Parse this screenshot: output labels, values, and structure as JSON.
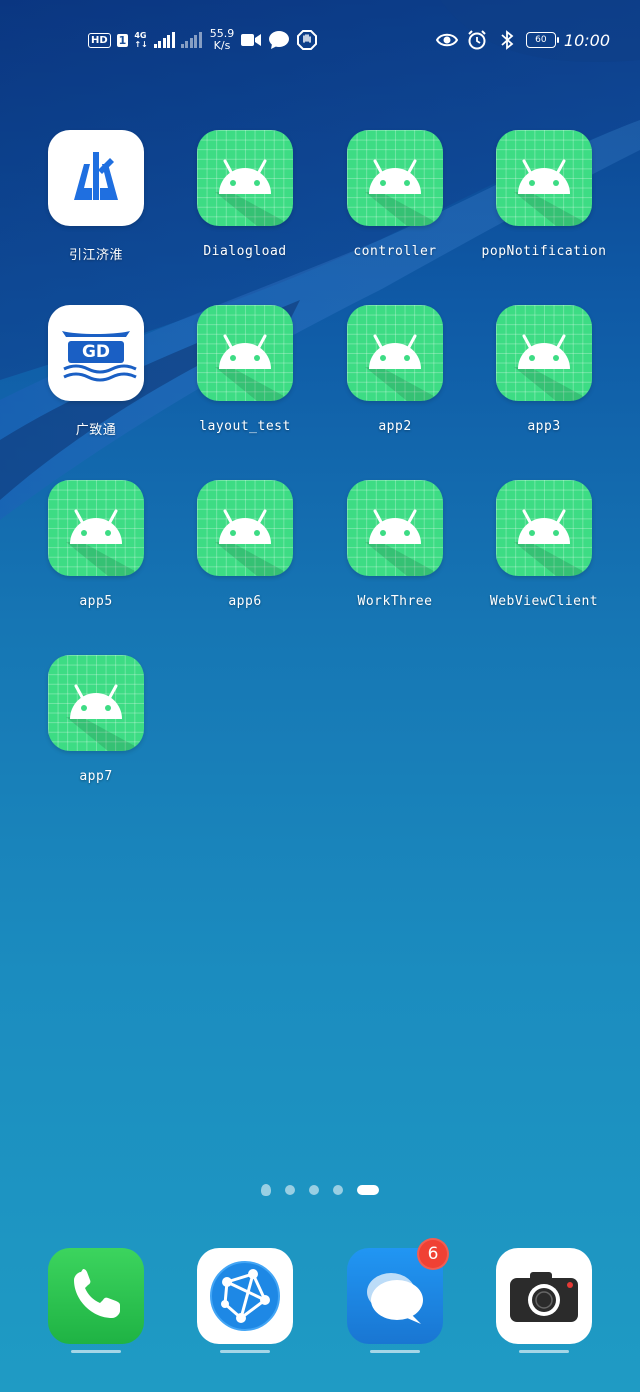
{
  "status_bar": {
    "hd": "HD",
    "sim": "1",
    "net": "4G",
    "net_sub": "↑↓",
    "speed_value": "55.9",
    "speed_unit": "K/s",
    "time": "10:00",
    "battery": "60"
  },
  "apps": [
    {
      "label": "引江济淮",
      "icon": "yjjh-logo-icon"
    },
    {
      "label": "Dialogload",
      "icon": "android-icon"
    },
    {
      "label": "controller",
      "icon": "android-icon"
    },
    {
      "label": "popNotification",
      "icon": "android-icon"
    },
    {
      "label": "广致通",
      "icon": "gzt-logo-icon"
    },
    {
      "label": "layout_test",
      "icon": "android-icon"
    },
    {
      "label": "app2",
      "icon": "android-icon"
    },
    {
      "label": "app3",
      "icon": "android-icon"
    },
    {
      "label": "app5",
      "icon": "android-icon"
    },
    {
      "label": "app6",
      "icon": "android-icon"
    },
    {
      "label": "WorkThree",
      "icon": "android-icon"
    },
    {
      "label": "WebViewClient",
      "icon": "android-icon"
    },
    {
      "label": "app7",
      "icon": "android-icon"
    }
  ],
  "gzt_logo_text": "GD",
  "page_indicator": {
    "count": 5,
    "active_index": 4
  },
  "dock": [
    {
      "icon": "phone-icon",
      "color": "#2fc24f"
    },
    {
      "icon": "browser-icon",
      "color": "#1e88e5"
    },
    {
      "icon": "messages-icon",
      "color": "#1e88e5",
      "badge": "6"
    },
    {
      "icon": "camera-icon",
      "color": "#2b2b2b"
    }
  ]
}
